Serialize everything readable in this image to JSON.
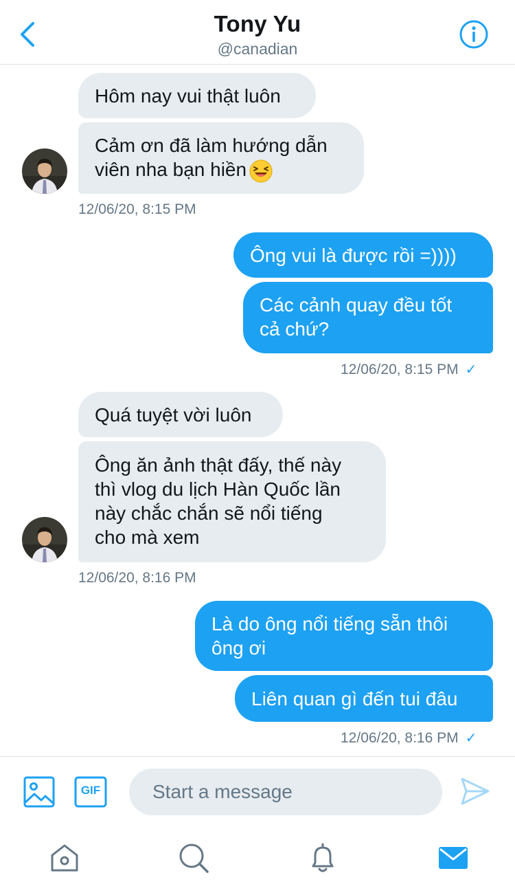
{
  "header": {
    "name": "Tony Yu",
    "handle": "@canadian",
    "back_icon": "chevron-left-icon",
    "info_icon": "info-icon"
  },
  "colors": {
    "accent": "#1da1f2",
    "incoming_bubble": "#e6ecf0",
    "secondary_text": "#657786"
  },
  "messages": {
    "m1": "Hôm nay vui thật luôn",
    "m2_line1": "Cảm ơn đã làm hướng dẫn",
    "m2_line2": "viên nha bạn hiền",
    "m2_emoji": "laughing-face-emoji",
    "t1": "12/06/20, 8:15 PM",
    "m3": "Ông vui là được rồi =))))",
    "m4_line1": "Các cảnh quay đều tốt",
    "m4_line2": "cả chứ?",
    "t2": "12/06/20, 8:15 PM",
    "m5": "Quá tuyệt vời luôn",
    "m6_line1": "Ông ăn ảnh thật đấy, thế này",
    "m6_line2": "thì vlog du lịch Hàn Quốc lần",
    "m6_line3": "này chắc chắn sẽ nổi tiếng",
    "m6_line4": "cho mà xem",
    "t3": "12/06/20, 8:16 PM",
    "m7_line1": "Là do ông nổi tiếng sẵn thôi",
    "m7_line2": "ông ơi",
    "m8": "Liên quan gì đến tui đâu",
    "t4": "12/06/20, 8:16 PM",
    "read_check": "✓"
  },
  "composer": {
    "placeholder": "Start a message",
    "gif_label": "GIF",
    "image_icon": "image-icon",
    "send_icon": "send-icon"
  },
  "tabbar": {
    "items": [
      "home-icon",
      "search-icon",
      "notifications-icon",
      "messages-icon"
    ],
    "active": "messages-icon"
  }
}
